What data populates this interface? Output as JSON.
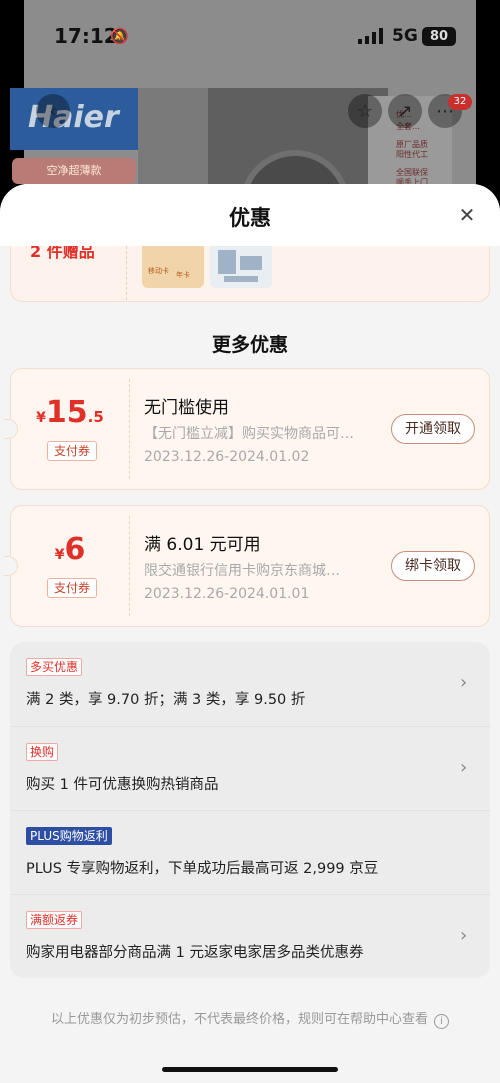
{
  "status_bar": {
    "time": "17:12",
    "network": "5G",
    "battery": "80"
  },
  "background": {
    "brand": "Haier",
    "promo_pill": "空净超薄款",
    "cart_badge": "32",
    "side_lines": [
      "优…",
      "全套…",
      "原厂品质",
      "阳性代工",
      "全国联保",
      "顺手上门"
    ]
  },
  "sheet": {
    "title": "优惠",
    "gift": {
      "text": "2 件赠品",
      "thumb_label_1": "移动卡",
      "thumb_label_2": "年卡"
    },
    "section_title": "更多优惠",
    "coupons": [
      {
        "currency": "¥",
        "amount": "15",
        "decimal": ".5",
        "type": "支付券",
        "title": "无门槛使用",
        "desc": "【无门槛立减】购买实物商品可…",
        "date": "2023.12.26-2024.01.02",
        "button": "开通领取"
      },
      {
        "currency": "¥",
        "amount": "6",
        "decimal": "",
        "type": "支付券",
        "title": "满 6.01 元可用",
        "desc": "限交通银行信用卡购京东商城…",
        "date": "2023.12.26-2024.01.01",
        "button": "绑卡领取"
      }
    ],
    "promos": [
      {
        "tag": "多买优惠",
        "tag_style": "red",
        "desc": "满 2 类，享 9.70 折；满 3 类，享 9.50 折",
        "has_arrow": true
      },
      {
        "tag": "换购",
        "tag_style": "red",
        "desc": "购买 1 件可优惠换购热销商品",
        "has_arrow": true
      },
      {
        "tag": "PLUS购物返利",
        "tag_style": "blue",
        "desc": "PLUS 专享购物返利，下单成功后最高可返 2,999 京豆",
        "has_arrow": false
      },
      {
        "tag": "满额返券",
        "tag_style": "red",
        "desc": "购家用电器部分商品满 1 元返家电家居多品类优惠券",
        "has_arrow": true
      }
    ],
    "footnote": "以上优惠仅为初步预估，不代表最终价格，规则可在帮助中心查看"
  },
  "colors": {
    "accent_red": "#e0302a",
    "plus_blue": "#2d4ea3",
    "sheet_bg": "#f4f4f4"
  },
  "icons": [
    "bell-muted-icon",
    "signal-icon",
    "back-icon",
    "star-icon",
    "share-icon",
    "more-icon",
    "close-icon",
    "chevron-right-icon",
    "info-icon"
  ]
}
